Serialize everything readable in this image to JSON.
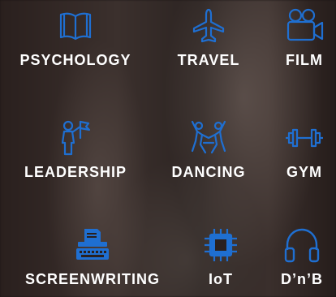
{
  "accent_color": "#1f6fd1",
  "tiles": [
    {
      "label": "PSYCHOLOGY",
      "icon": "book-icon"
    },
    {
      "label": "TRAVEL",
      "icon": "airplane-icon"
    },
    {
      "label": "FILM",
      "icon": "video-camera-icon"
    },
    {
      "label": "LEADERSHIP",
      "icon": "leader-flag-icon"
    },
    {
      "label": "DANCING",
      "icon": "dancers-icon"
    },
    {
      "label": "GYM",
      "icon": "dumbbell-icon"
    },
    {
      "label": "SCREENWRITING",
      "icon": "typewriter-icon"
    },
    {
      "label": "IoT",
      "icon": "chip-icon"
    },
    {
      "label": "D’n’B",
      "icon": "headphones-icon"
    }
  ]
}
